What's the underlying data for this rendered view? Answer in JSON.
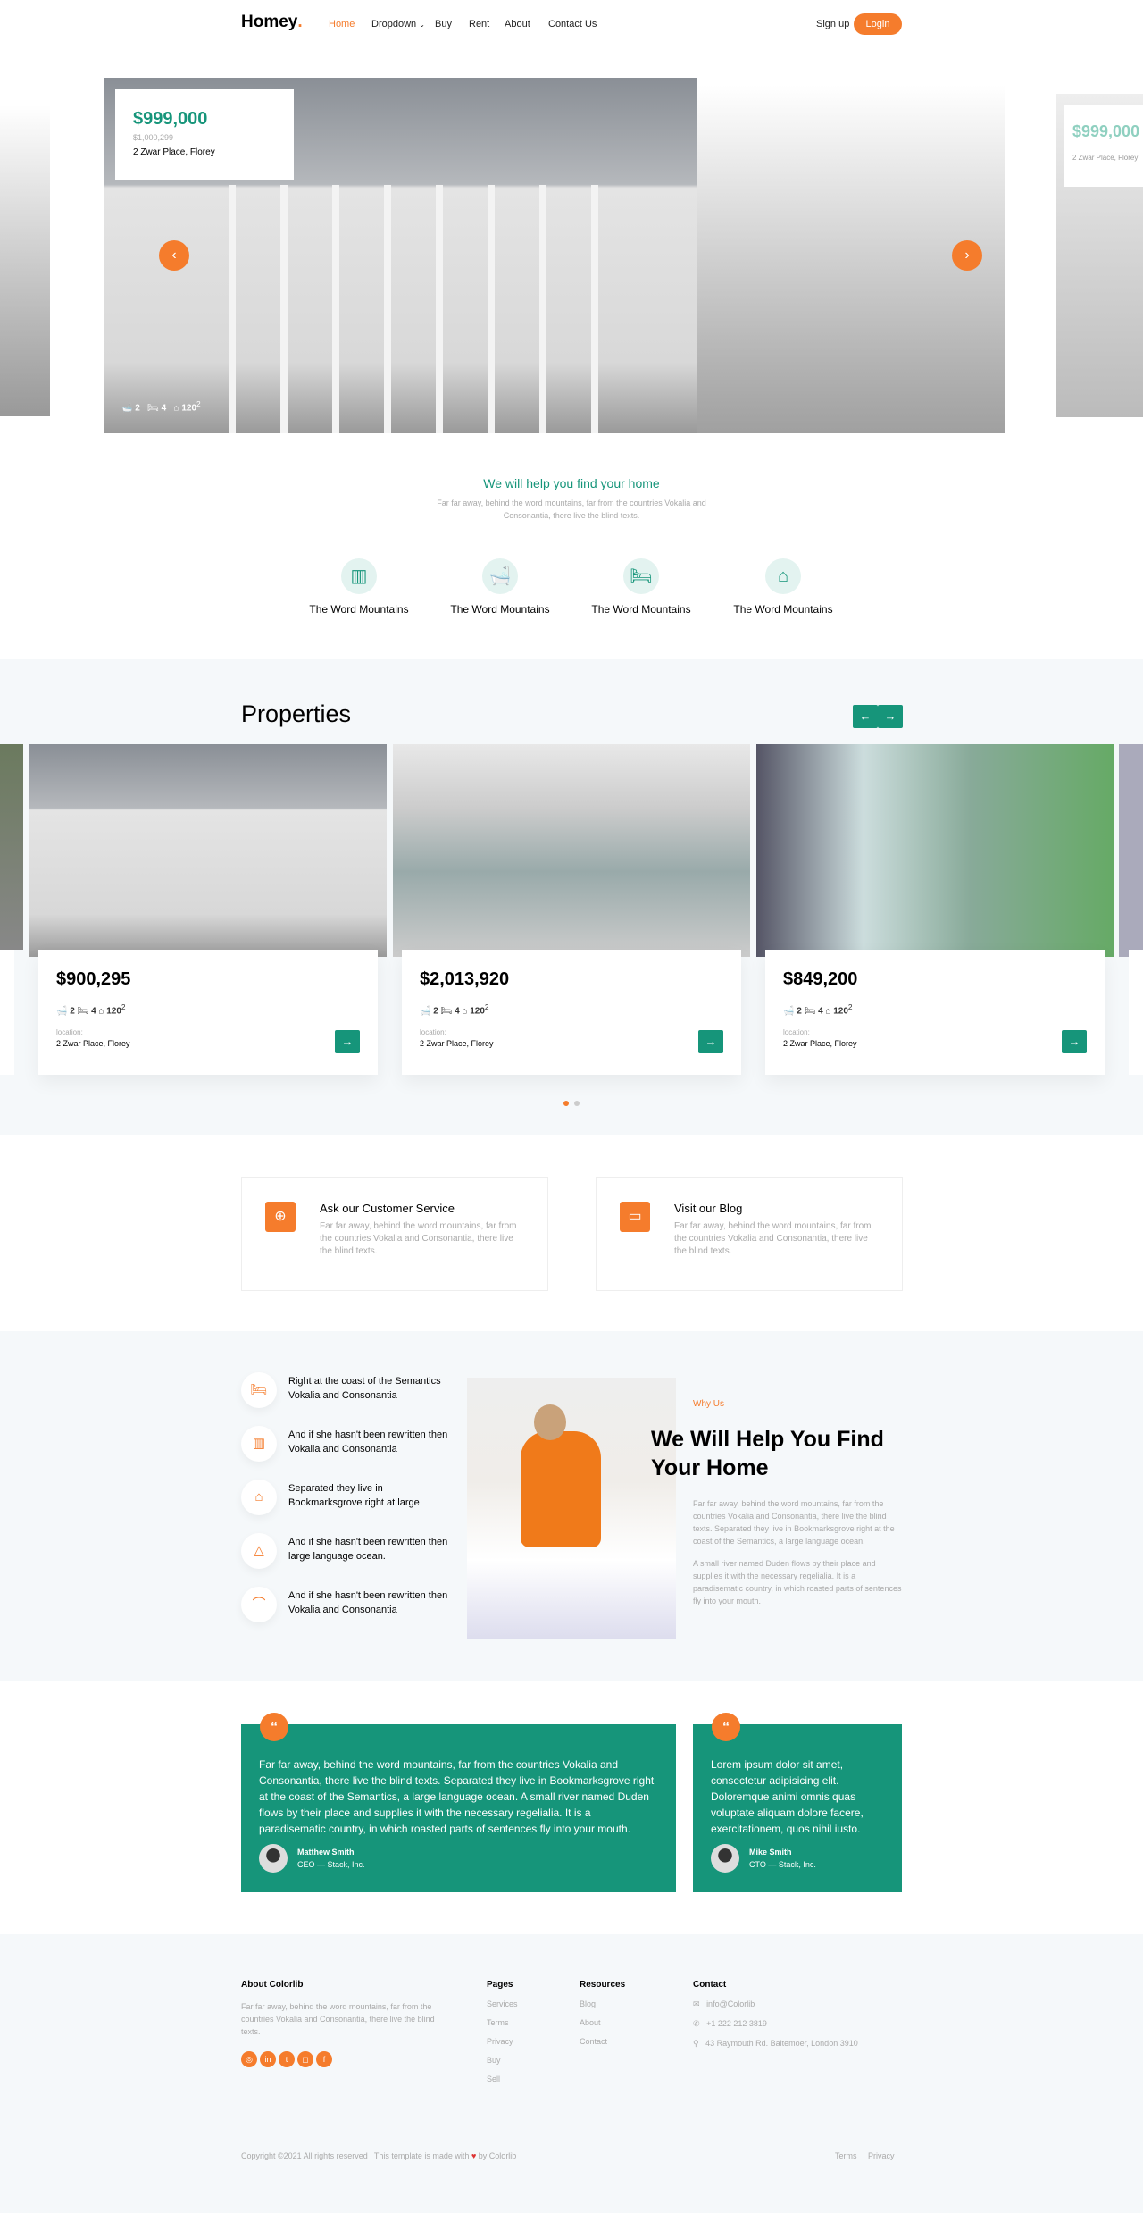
{
  "nav": {
    "logo": "Homey",
    "logo_dot": ".",
    "items": [
      "Home",
      "Dropdown",
      "Buy",
      "Rent",
      "About",
      "Contact Us"
    ],
    "signup": "Sign up",
    "login": "Login",
    "active_color": "#f57c2c"
  },
  "hero": {
    "price": "$999,000",
    "old_price": "$1,000,299",
    "address": "2 Zwar Place, Florey",
    "baths": "2",
    "beds": "4",
    "area": "120",
    "area_sup": "2",
    "peek_price": "$999,000",
    "peek_address": "2 Zwar Place, Florey"
  },
  "help": {
    "title": "We will help you find your home",
    "text": "Far far away, behind the word mountains, far from the countries Vokalia and Consonantia, there live the blind texts.",
    "features": [
      {
        "icon": "building-icon",
        "label": "The Word Mountains"
      },
      {
        "icon": "bathtub-icon",
        "label": "The Word Mountains"
      },
      {
        "icon": "bed-icon",
        "label": "The Word Mountains"
      },
      {
        "icon": "house-area-icon",
        "label": "The Word Mountains"
      }
    ]
  },
  "properties": {
    "title": "Properties",
    "location_label": "location:",
    "items": [
      {
        "price": "$900,295",
        "baths": "2",
        "beds": "4",
        "area": "120",
        "address": "2 Zwar Place, Florey"
      },
      {
        "price": "$2,013,920",
        "baths": "2",
        "beds": "4",
        "area": "120",
        "address": "2 Zwar Place, Florey"
      },
      {
        "price": "$849,200",
        "baths": "2",
        "beds": "4",
        "area": "120",
        "address": "2 Zwar Place, Florey"
      }
    ],
    "dots": 2,
    "active_dot": 1
  },
  "services": [
    {
      "icon": "lifebuoy-icon",
      "title": "Ask our Customer Service",
      "text": "Far far away, behind the word mountains, far from the countries Vokalia and Consonantia, there live the blind texts."
    },
    {
      "icon": "chat-icon",
      "title": "Visit our Blog",
      "text": "Far far away, behind the word mountains, far from the countries Vokalia and Consonantia, there live the blind texts."
    }
  ],
  "why": {
    "items": [
      {
        "icon": "bed-icon",
        "text": "Right at the coast of the Semantics Vokalia and Consonantia"
      },
      {
        "icon": "building-icon",
        "text": "And if she hasn't been rewritten then Vokalia and Consonantia"
      },
      {
        "icon": "garage-car-icon",
        "text": "Separated they live in Bookmarksgrove right at large"
      },
      {
        "icon": "map-pin-icon",
        "text": "And if she hasn't been rewritten then large language ocean."
      },
      {
        "icon": "shower-icon",
        "text": "And if she hasn't been rewritten then Vokalia and Consonantia"
      }
    ],
    "eyebrow": "Why Us",
    "title": "We Will Help You Find Your Home",
    "p1": "Far far away, behind the word mountains, far from the countries Vokalia and Consonantia, there live the blind texts. Separated they live in Bookmarksgrove right at the coast of the Semantics, a large language ocean.",
    "p2": "A small river named Duden flows by their place and supplies it with the necessary regelialia. It is a paradisematic country, in which roasted parts of sentences fly into your mouth."
  },
  "testimonials": [
    {
      "text": "Far far away, behind the word mountains, far from the countries Vokalia and Consonantia, there live the blind texts. Separated they live in Bookmarksgrove right at the coast of the Semantics, a large language ocean. A small river named Duden flows by their place and supplies it with the necessary regelialia. It is a paradisematic country, in which roasted parts of sentences fly into your mouth.",
      "name": "Matthew Smith",
      "role": "CEO — Stack, Inc."
    },
    {
      "text": "Lorem ipsum dolor sit amet, consectetur adipisicing elit. Doloremque animi omnis quas voluptate aliquam dolore facere, exercitationem, quos nihil iusto.",
      "name": "Mike Smith",
      "role": "CTO — Stack, Inc."
    }
  ],
  "footer": {
    "about_title": "About Colorlib",
    "about_text": "Far far away, behind the word mountains, far from the countries Vokalia and Consonantia, there live the blind texts.",
    "social": [
      "dribbble-icon",
      "linkedin-icon",
      "twitter-icon",
      "instagram-icon",
      "facebook-icon"
    ],
    "pages_title": "Pages",
    "pages": [
      "Services",
      "Terms",
      "Privacy",
      "Buy",
      "Sell"
    ],
    "resources_title": "Resources",
    "resources": [
      "Blog",
      "About",
      "Contact"
    ],
    "contact_title": "Contact",
    "email": "info@Colorlib",
    "phone": "+1 222 212 3819",
    "address": "43 Raymouth Rd. Baltemoer, London 3910",
    "copyright": "Copyright ©2021 All rights reserved | This template is made with",
    "by": "by Colorlib",
    "bottom_links": [
      "Terms",
      "Privacy"
    ]
  },
  "colors": {
    "accent": "#f57c2c",
    "primary": "#16957a"
  }
}
